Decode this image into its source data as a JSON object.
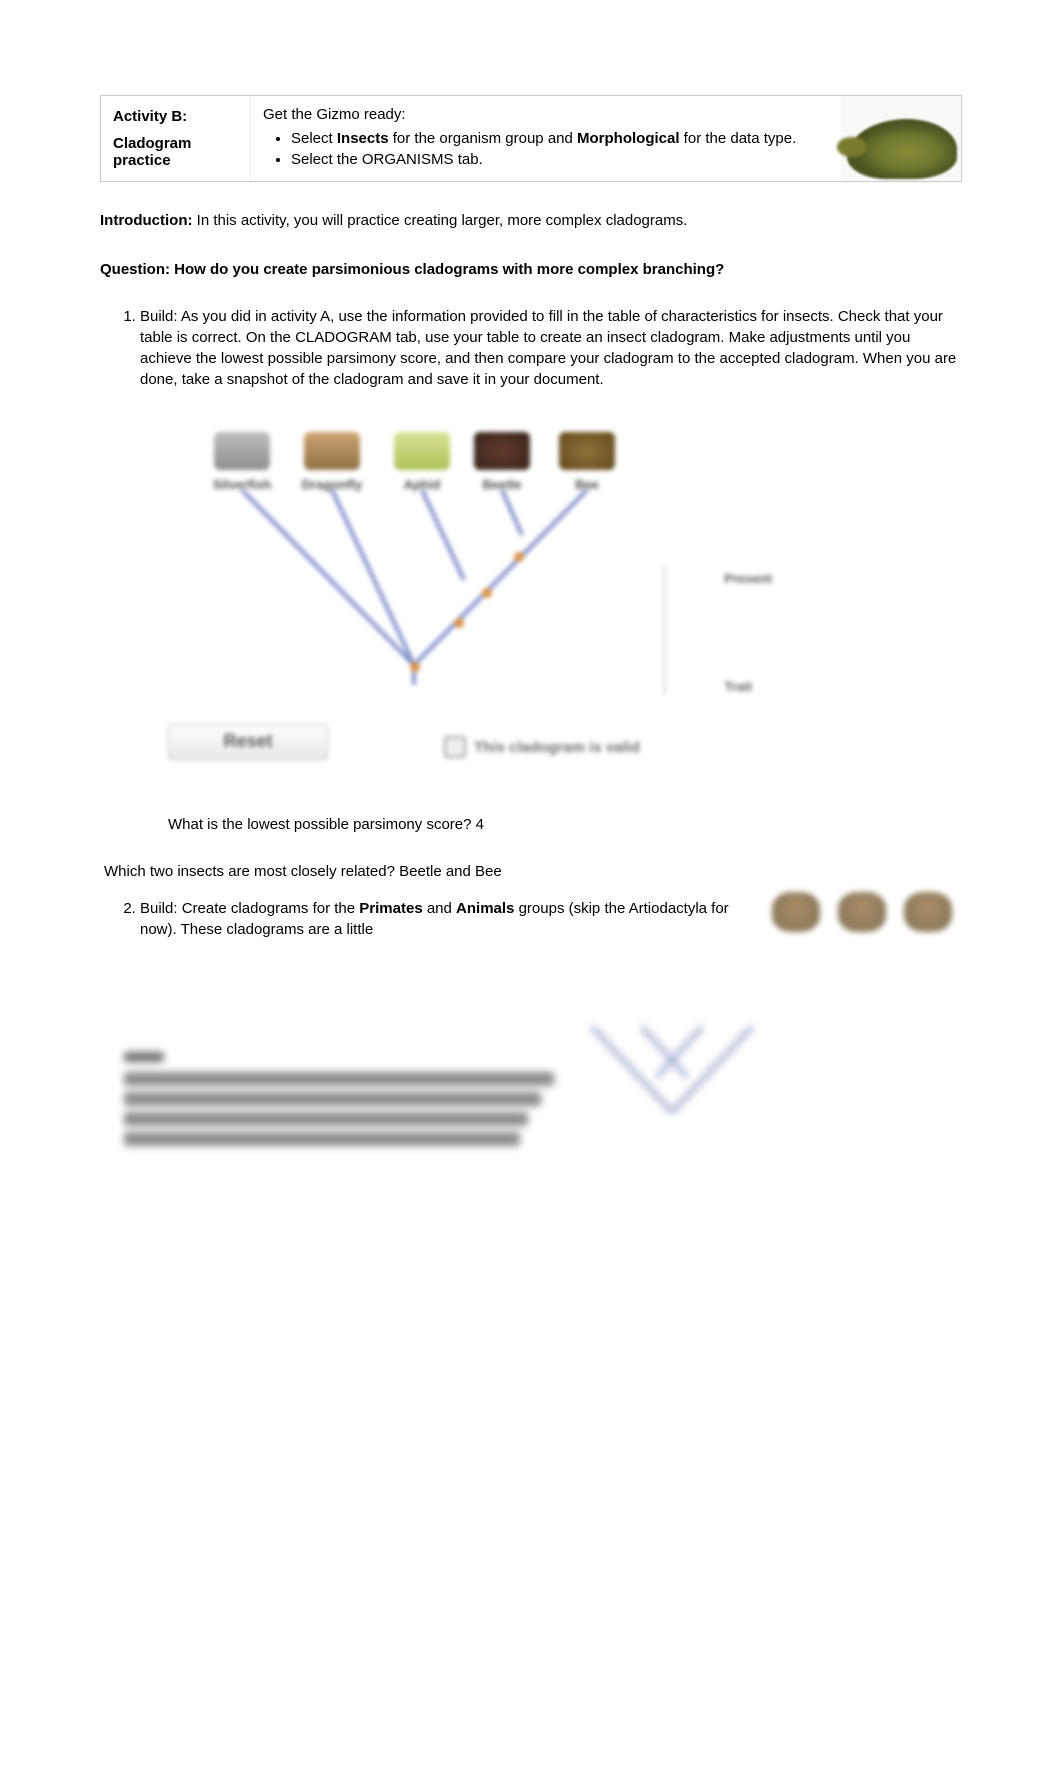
{
  "header": {
    "activity_label": "Activity B:",
    "activity_title_line1": "Cladogram",
    "activity_title_line2": "practice",
    "ready": "Get the Gizmo ready:",
    "bullet1_pre": "Select ",
    "bullet1_bold1": "Insects",
    "bullet1_mid": " for the organism group and ",
    "bullet1_bold2": "Morphological",
    "bullet1_post": " for the data type.",
    "bullet2": "Select the ORGANISMS tab."
  },
  "intro_label": "Introduction:",
  "intro_text": " In this activity, you will practice creating larger, more complex cladograms.",
  "question_label": "Question: How do you create parsimonious cladograms with more complex branching?",
  "item1": {
    "label": "Build:",
    "text": " As you did in activity A, use the information provided to fill in the table of characteristics for insects. Check that your table is correct. On the CLADOGRAM tab, use your table to create an insect cladogram. Make adjustments until you achieve the lowest possible parsimony score, and then compare your cladogram to the accepted cladogram. When you are done, take a snapshot of the cladogram and save it in your document."
  },
  "figure": {
    "organisms": [
      "Silverfish",
      "Dragonfly",
      "Aphid",
      "Beetle",
      "Bee"
    ],
    "legend_top": "Present",
    "legend_bottom": "Trait",
    "reset": "Reset",
    "valid_label": "This cladogram is valid"
  },
  "q_parsimony_q": "What is the lowest possible parsimony score? ",
  "q_parsimony_a": "4",
  "q_related_q": "Which two insects are most closely related? ",
  "q_related_a": "Beetle and Bee",
  "item2": {
    "label": "Build:",
    "pre": " Create cladograms for the ",
    "b1": "Primates",
    "mid": " and ",
    "b2": "Animals",
    "post": " groups (skip the Artiodactyla for now). These cladograms are a little"
  }
}
